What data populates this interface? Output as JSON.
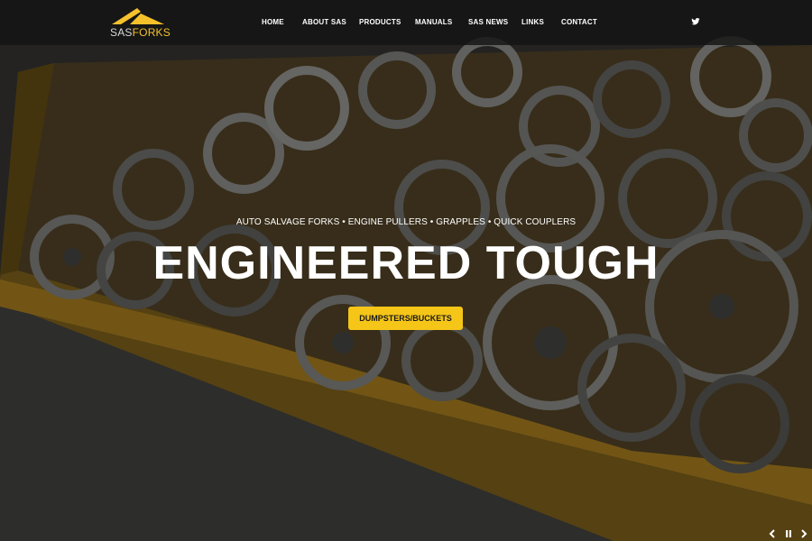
{
  "logo": {
    "text_a": "SAS",
    "text_b": "FORKS",
    "accent_color": "#f5c12b"
  },
  "nav": {
    "items": [
      "HOME",
      "ABOUT SAS",
      "PRODUCTS",
      "MANUALS",
      "SAS NEWS",
      "LINKS",
      "CONTACT"
    ]
  },
  "social": {
    "twitter_icon": "twitter-icon"
  },
  "hero": {
    "tagline": "AUTO SALVAGE FORKS • ENGINE PULLERS • GRAPPLES • QUICK COUPLERS",
    "headline": "ENGINEERED TOUGH",
    "cta_label": "DUMPSTERS/BUCKETS",
    "cta_color": "#f5c518"
  },
  "slider": {
    "prev_icon": "chevron-left-icon",
    "pause_icon": "pause-icon",
    "next_icon": "chevron-right-icon"
  }
}
